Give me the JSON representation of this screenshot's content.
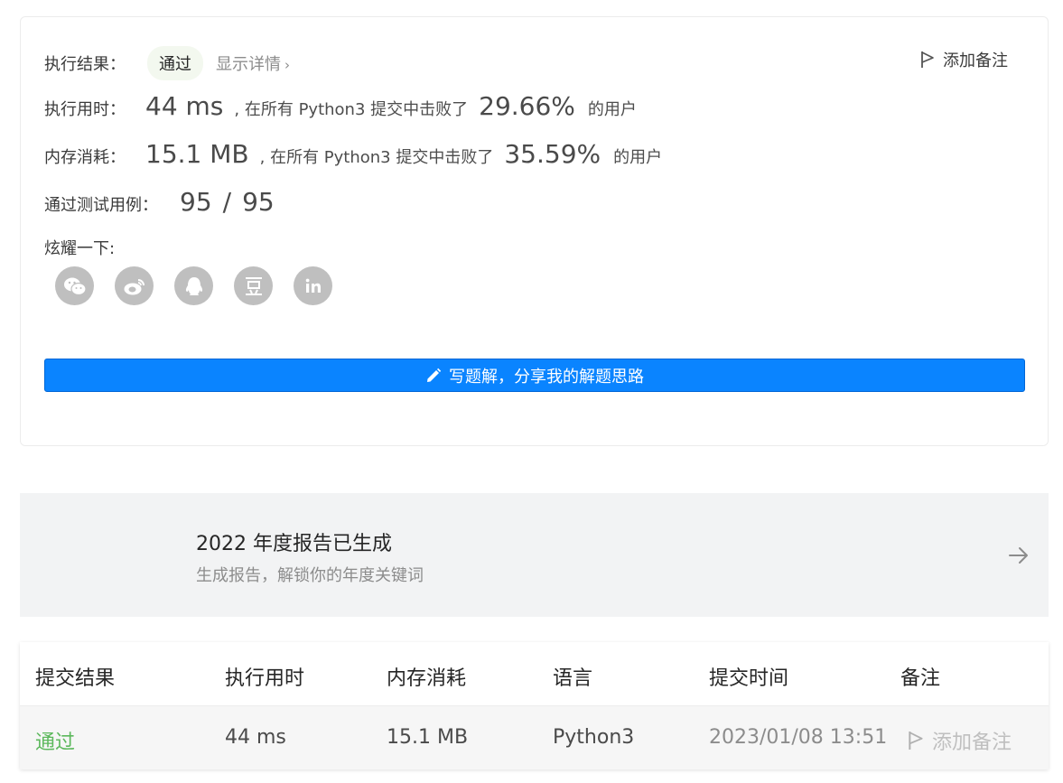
{
  "result": {
    "status_label": "执行结果：",
    "status_value": "通过",
    "details_link": "显示详情",
    "add_note": "添加备注",
    "runtime": {
      "label": "执行用时：",
      "value": "44 ms",
      "mid_text": ", 在所有 Python3 提交中击败了",
      "percent": "29.66%",
      "suffix": "的用户"
    },
    "memory": {
      "label": "内存消耗：",
      "value": "15.1 MB",
      "mid_text": ", 在所有 Python3 提交中击败了",
      "percent": "35.59%",
      "suffix": "的用户"
    },
    "testcases": {
      "label": "通过测试用例：",
      "passed": "95",
      "sep": "/",
      "total": "95"
    },
    "share_label": "炫耀一下:",
    "share_icons": [
      "wechat-icon",
      "weibo-icon",
      "qq-icon",
      "douban-icon",
      "linkedin-icon"
    ],
    "write_solution": "写题解，分享我的解题思路"
  },
  "banner": {
    "title": "2022 年度报告已生成",
    "subtitle": "生成报告，解锁你的年度关键词"
  },
  "table": {
    "headers": [
      "提交结果",
      "执行用时",
      "内存消耗",
      "语言",
      "提交时间",
      "备注"
    ],
    "rows": [
      [
        "通过",
        "44 ms",
        "15.1 MB",
        "Python3",
        "2023/01/08 13:51",
        "添加备注"
      ]
    ]
  },
  "colors": {
    "primary": "#0a84ff",
    "pass_green": "#5cb85c",
    "badge_bg": "#f3f8ef",
    "banner_bg": "#f2f3f4",
    "icon_gray": "#bfbfbf"
  }
}
